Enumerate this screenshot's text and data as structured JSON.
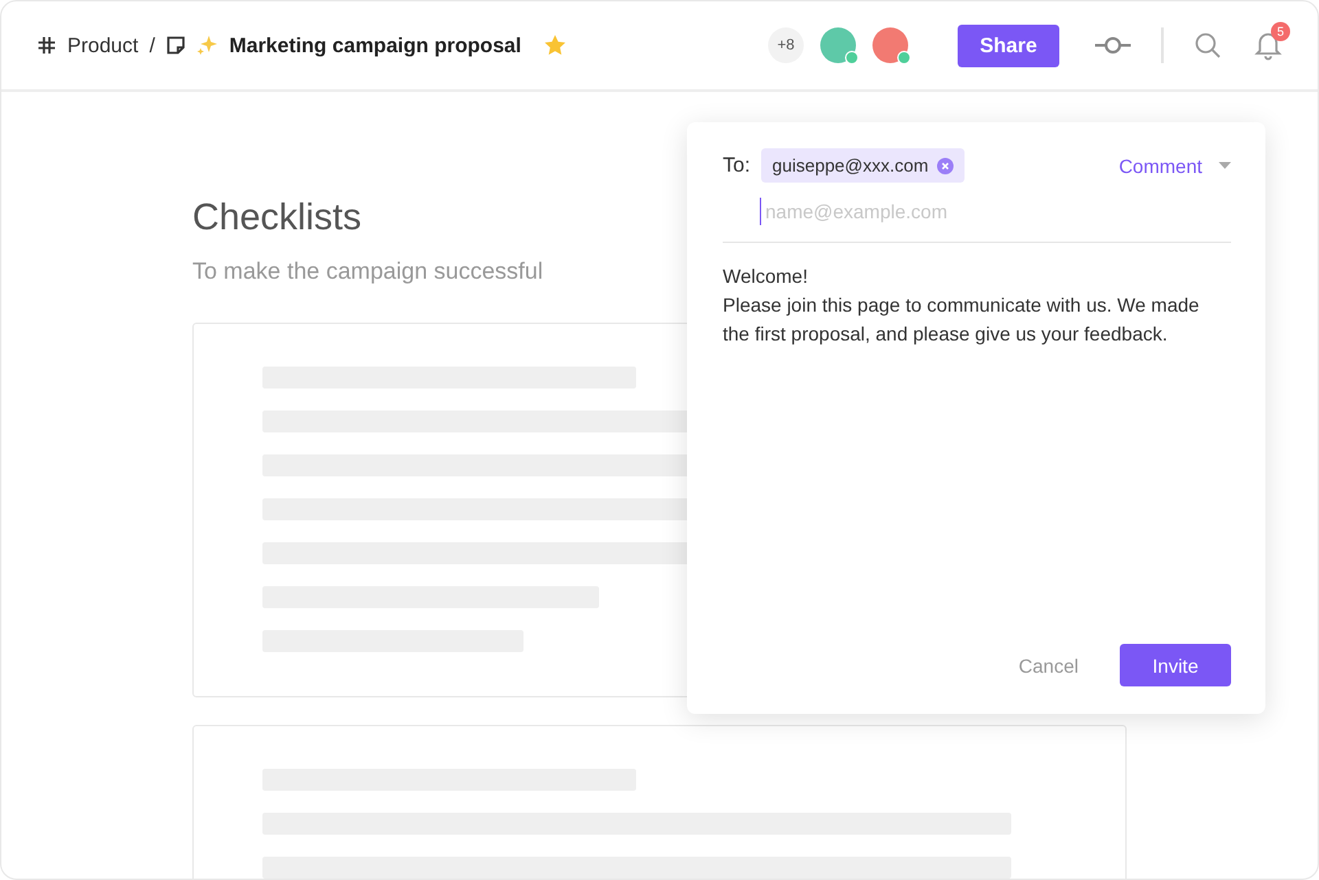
{
  "breadcrumb": {
    "space": "Product",
    "separator": "/",
    "title": "Marketing campaign proposal",
    "starred": true
  },
  "header": {
    "extra_members": "+8",
    "avatars": [
      {
        "online": true,
        "color": "#5ec9a8"
      },
      {
        "online": true,
        "color": "#f27a72"
      }
    ],
    "share": "Share",
    "notifications": "5"
  },
  "document": {
    "heading": "Checklists",
    "subtitle": "To make the campaign successful"
  },
  "invite_dialog": {
    "to_label": "To:",
    "recipients": [
      {
        "email": "guiseppe@xxx.com"
      }
    ],
    "placeholder": "name@example.com",
    "role": "Comment",
    "greeting": "Welcome!",
    "message": "Please join this page to communicate with us. We made the first proposal, and please give us your feedback.",
    "cancel": "Cancel",
    "invite": "Invite"
  }
}
